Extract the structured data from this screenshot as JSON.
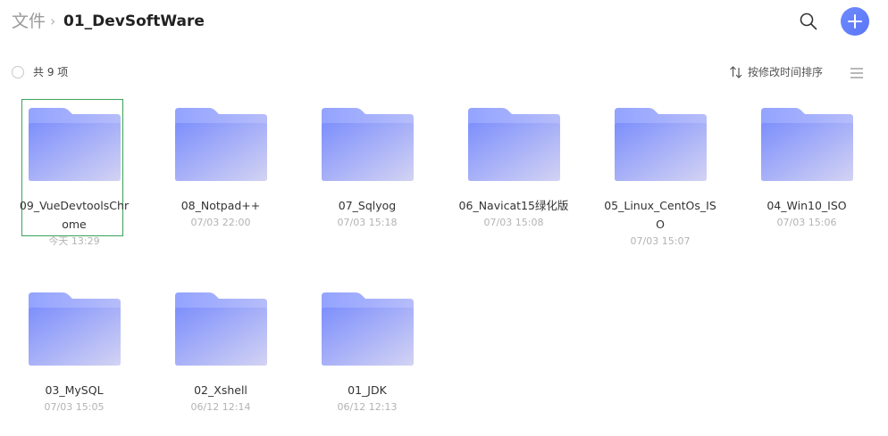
{
  "breadcrumb": {
    "root": "文件",
    "separator": "›",
    "current": "01_DevSoftWare"
  },
  "toolbar": {
    "count_label": "共 9 项",
    "sort_label": "按修改时间排序"
  },
  "icons": {
    "search": "search-icon",
    "add": "plus-icon",
    "sort": "sort-arrows-icon",
    "view": "list-view-icon",
    "folder": "folder-icon"
  },
  "colors": {
    "accent": "#6079f8",
    "selection": "#3aa35a",
    "folder_back": "#9fb0ff",
    "folder_front_start": "#7d8ffc",
    "folder_front_end": "#cfd1f4"
  },
  "folders": [
    {
      "name": "09_VueDevtoolsChrome",
      "date": "今天 13:29",
      "selected": true
    },
    {
      "name": "08_Notpad++",
      "date": "07/03 22:00",
      "selected": false
    },
    {
      "name": "07_Sqlyog",
      "date": "07/03 15:18",
      "selected": false
    },
    {
      "name": "06_Navicat15绿化版",
      "date": "07/03 15:08",
      "selected": false
    },
    {
      "name": "05_Linux_CentOs_ISO",
      "date": "07/03 15:07",
      "selected": false
    },
    {
      "name": "04_Win10_ISO",
      "date": "07/03 15:06",
      "selected": false
    },
    {
      "name": "03_MySQL",
      "date": "07/03 15:05",
      "selected": false
    },
    {
      "name": "02_Xshell",
      "date": "06/12 12:14",
      "selected": false
    },
    {
      "name": "01_JDK",
      "date": "06/12 12:13",
      "selected": false
    }
  ]
}
